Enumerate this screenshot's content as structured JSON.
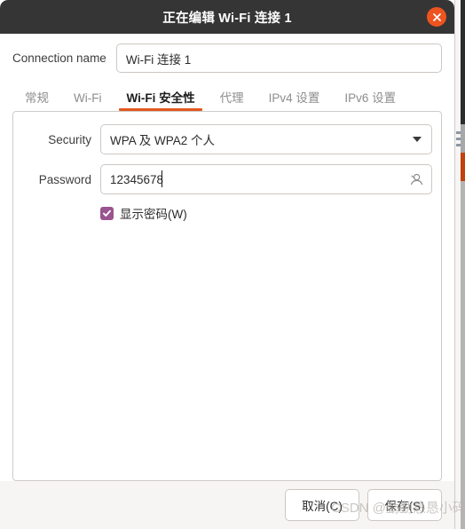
{
  "window": {
    "title": "正在编辑 Wi-Fi 连接 1",
    "close_icon": "close-icon",
    "close_color": "#ed5420",
    "titlebar_color": "#353535"
  },
  "connection": {
    "label": "Connection name",
    "value": "Wi-Fi 连接 1",
    "placeholder": ""
  },
  "tabs": [
    {
      "label": "常规",
      "active": false
    },
    {
      "label": "Wi-Fi",
      "active": false
    },
    {
      "label": "Wi-Fi 安全性",
      "active": true
    },
    {
      "label": "代理",
      "active": false
    },
    {
      "label": "IPv4 设置",
      "active": false
    },
    {
      "label": "IPv6 设置",
      "active": false
    }
  ],
  "tab_accent_color": "#e3571f",
  "form": {
    "security": {
      "label": "Security",
      "value": "WPA 及 WPA2 个人",
      "arrow_icon": "chevron-down-icon"
    },
    "password": {
      "label": "Password",
      "value": "12345678",
      "placeholder": "",
      "icon": "person-icon"
    },
    "show_password": {
      "label": "显示密码(W)",
      "checked": true,
      "color": "#9a5490"
    }
  },
  "footer": {
    "cancel_label": "取消(C)",
    "save_label": "保存(S)"
  },
  "watermark": {
    "text": "CSDN @勤勤恳恳小码牛"
  }
}
